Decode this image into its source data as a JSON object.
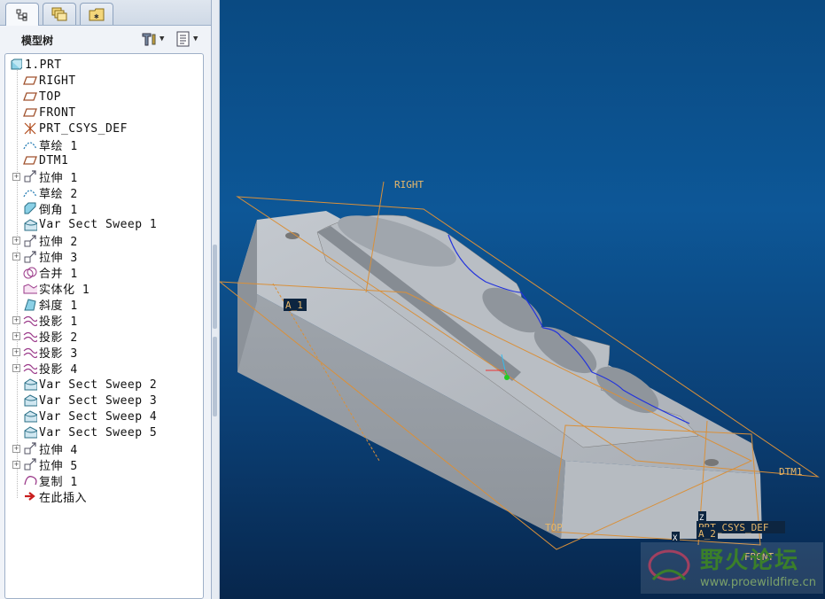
{
  "panel": {
    "title": "模型树",
    "tabs": [
      "model-tree",
      "layers",
      "folder"
    ],
    "tools": [
      {
        "icon": "settings-icon"
      },
      {
        "icon": "show-icon"
      }
    ]
  },
  "tree": [
    {
      "label": "1.PRT",
      "icon": "part-icon",
      "expand": false
    },
    {
      "label": "RIGHT",
      "icon": "datum-plane-icon",
      "expand": false
    },
    {
      "label": "TOP",
      "icon": "datum-plane-icon",
      "expand": false
    },
    {
      "label": "FRONT",
      "icon": "datum-plane-icon",
      "expand": false
    },
    {
      "label": "PRT_CSYS_DEF",
      "icon": "csys-icon",
      "expand": false
    },
    {
      "label": "草绘 1",
      "icon": "sketch-icon",
      "expand": false
    },
    {
      "label": "DTM1",
      "icon": "datum-plane-icon",
      "expand": false
    },
    {
      "label": "拉伸 1",
      "icon": "extrude-icon",
      "expand": true
    },
    {
      "label": "草绘 2",
      "icon": "sketch-icon",
      "expand": false
    },
    {
      "label": "倒角 1",
      "icon": "chamfer-icon",
      "expand": false
    },
    {
      "label": "Var Sect Sweep 1",
      "icon": "sweep-icon",
      "expand": false
    },
    {
      "label": "拉伸 2",
      "icon": "extrude-icon",
      "expand": true
    },
    {
      "label": "拉伸 3",
      "icon": "extrude-icon",
      "expand": true
    },
    {
      "label": "合并 1",
      "icon": "merge-icon",
      "expand": false
    },
    {
      "label": "实体化 1",
      "icon": "solidify-icon",
      "expand": false
    },
    {
      "label": "斜度 1",
      "icon": "draft-icon",
      "expand": false
    },
    {
      "label": "投影 1",
      "icon": "projection-icon",
      "expand": true
    },
    {
      "label": "投影 2",
      "icon": "projection-icon",
      "expand": true
    },
    {
      "label": "投影 3",
      "icon": "projection-icon",
      "expand": true
    },
    {
      "label": "投影 4",
      "icon": "projection-icon",
      "expand": true
    },
    {
      "label": "Var Sect Sweep 2",
      "icon": "sweep-icon",
      "expand": false
    },
    {
      "label": "Var Sect Sweep 3",
      "icon": "sweep-icon",
      "expand": false
    },
    {
      "label": "Var Sect Sweep 4",
      "icon": "sweep-icon",
      "expand": false
    },
    {
      "label": "Var Sect Sweep 5",
      "icon": "sweep-icon",
      "expand": false
    },
    {
      "label": "拉伸 4",
      "icon": "extrude-icon",
      "expand": true
    },
    {
      "label": "拉伸 5",
      "icon": "extrude-icon",
      "expand": true
    },
    {
      "label": "复制 1",
      "icon": "copy-icon",
      "expand": false
    },
    {
      "label": "在此插入",
      "icon": "insert-here-icon",
      "expand": false
    }
  ],
  "viewport": {
    "datums": {
      "right": "RIGHT",
      "a1": "A_1",
      "dtm1": "DTM1",
      "top": "TOP",
      "csys": "PRT_CSYS_DEF",
      "a2": "A_2",
      "front": "FRONT",
      "z": "Z",
      "x": "X"
    },
    "colors": {
      "datum": "#d9903a",
      "body": "#a7adb3",
      "curve": "#2233dd"
    }
  },
  "watermark": {
    "title": "野火论坛",
    "url": "www.proewildfire.cn"
  }
}
